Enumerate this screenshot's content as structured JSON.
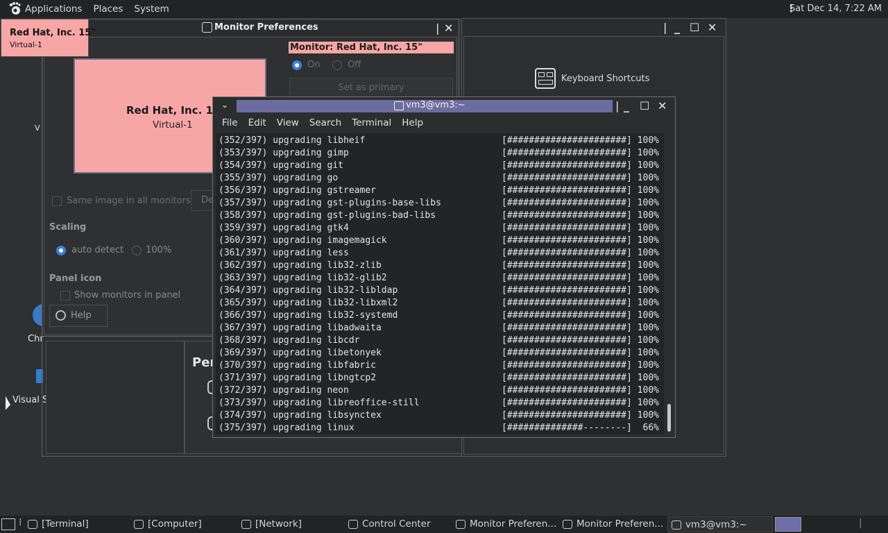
{
  "top_panel": {
    "menus": [
      "Applications",
      "Places",
      "System"
    ],
    "clock": "Sat Dec 14,  7:22 AM"
  },
  "desktop": {
    "icon_labels_partial": [
      "V",
      "Chr",
      "Visual S"
    ]
  },
  "control_center": {
    "keyboard_shortcuts": "Keyboard Shortcuts",
    "per_fragment": "Per"
  },
  "monitor_prefs": {
    "title": "Monitor Preferences",
    "preview_name": "Red Hat, Inc. 15\"",
    "preview_sub": "Virtual-1",
    "monitor_label": "Monitor: Red Hat, Inc. 15\"",
    "on_label": "On",
    "off_label": "Off",
    "set_primary": "Set as primary",
    "same_image": "Same image in all monitors",
    "detect_fragment": "De",
    "scaling_head": "Scaling",
    "auto_detect": "auto detect",
    "pct_100": "100%",
    "panel_icon_head": "Panel icon",
    "show_monitors": "Show monitors in panel",
    "help": "Help"
  },
  "tooltip": {
    "name": "Red Hat, Inc. 15\"",
    "sub": "Virtual-1"
  },
  "terminal": {
    "title": "vm3@vm3:~",
    "menu": [
      "File",
      "Edit",
      "View",
      "Search",
      "Terminal",
      "Help"
    ],
    "lines": [
      {
        "left": "(352/397) upgrading libheif",
        "right": "[######################] 100%"
      },
      {
        "left": "(353/397) upgrading gimp",
        "right": "[######################] 100%"
      },
      {
        "left": "(354/397) upgrading git",
        "right": "[######################] 100%"
      },
      {
        "left": "(355/397) upgrading go",
        "right": "[######################] 100%"
      },
      {
        "left": "(356/397) upgrading gstreamer",
        "right": "[######################] 100%"
      },
      {
        "left": "(357/397) upgrading gst-plugins-base-libs",
        "right": "[######################] 100%"
      },
      {
        "left": "(358/397) upgrading gst-plugins-bad-libs",
        "right": "[######################] 100%"
      },
      {
        "left": "(359/397) upgrading gtk4",
        "right": "[######################] 100%"
      },
      {
        "left": "(360/397) upgrading imagemagick",
        "right": "[######################] 100%"
      },
      {
        "left": "(361/397) upgrading less",
        "right": "[######################] 100%"
      },
      {
        "left": "(362/397) upgrading lib32-zlib",
        "right": "[######################] 100%"
      },
      {
        "left": "(363/397) upgrading lib32-glib2",
        "right": "[######################] 100%"
      },
      {
        "left": "(364/397) upgrading lib32-libldap",
        "right": "[######################] 100%"
      },
      {
        "left": "(365/397) upgrading lib32-libxml2",
        "right": "[######################] 100%"
      },
      {
        "left": "(366/397) upgrading lib32-systemd",
        "right": "[######################] 100%"
      },
      {
        "left": "(367/397) upgrading libadwaita",
        "right": "[######################] 100%"
      },
      {
        "left": "(368/397) upgrading libcdr",
        "right": "[######################] 100%"
      },
      {
        "left": "(369/397) upgrading libetonyek",
        "right": "[######################] 100%"
      },
      {
        "left": "(370/397) upgrading libfabric",
        "right": "[######################] 100%"
      },
      {
        "left": "(371/397) upgrading libngtcp2",
        "right": "[######################] 100%"
      },
      {
        "left": "(372/397) upgrading neon",
        "right": "[######################] 100%"
      },
      {
        "left": "(373/397) upgrading libreoffice-still",
        "right": "[######################] 100%"
      },
      {
        "left": "(374/397) upgrading libsynctex",
        "right": "[######################] 100%"
      },
      {
        "left": "(375/397) upgrading linux",
        "right": "[##############--------]  66%"
      }
    ]
  },
  "taskbar": {
    "items": [
      "[Terminal]",
      "[Computer]",
      "[Network]",
      "Control Center",
      "Monitor Preferen...",
      "Monitor Preferen...",
      "vm3@vm3:~"
    ]
  },
  "colors": {
    "monitor_highlight": "#f7a6a6",
    "terminal_title": "#6c6ca0",
    "accent_blue": "#3c7fd8"
  }
}
